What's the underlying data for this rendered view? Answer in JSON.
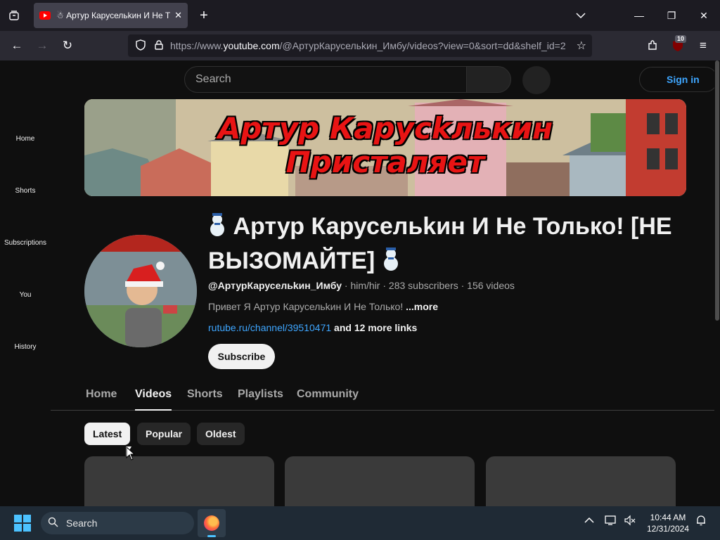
{
  "browser": {
    "tab_title": "☃ Артур Карусельkин И Не Т",
    "url_prefix": "https://www.",
    "url_domain": "youtube.com",
    "url_rest": "/@АртурКарусельkин_Имбу/videos?view=0&sort=dd&shelf_id=2",
    "extension_badge": "10"
  },
  "sidebar": {
    "items": [
      {
        "label": "Home"
      },
      {
        "label": "Shorts"
      },
      {
        "label": "Subscriptions"
      },
      {
        "label": "You"
      },
      {
        "label": "History"
      }
    ]
  },
  "header": {
    "search_placeholder": "Search",
    "signin_label": "Sign in"
  },
  "banner": {
    "line1": "Артур Карусkлькин",
    "line2": "Присталяет"
  },
  "channel": {
    "title": "Артур Карусельkин И Не Только! [НЕ ВЫЗОМАЙТЕ]",
    "handle": "@АртурКарусельkин_Имбу",
    "pronouns": "him/hir",
    "subscribers": "283 subscribers",
    "videos": "156 videos",
    "description": "Привет Я Артур Карусельkин И Не Только!",
    "more_label": "...more",
    "link": "rutube.ru/channel/39510471",
    "more_links": "and 12 more links",
    "subscribe_label": "Subscribe"
  },
  "tabs": [
    {
      "label": "Home"
    },
    {
      "label": "Videos"
    },
    {
      "label": "Shorts"
    },
    {
      "label": "Playlists"
    },
    {
      "label": "Community"
    }
  ],
  "filters": [
    {
      "label": "Latest"
    },
    {
      "label": "Popular"
    },
    {
      "label": "Oldest"
    }
  ],
  "taskbar": {
    "search_label": "Search",
    "time": "10:44 AM",
    "date": "12/31/2024"
  }
}
